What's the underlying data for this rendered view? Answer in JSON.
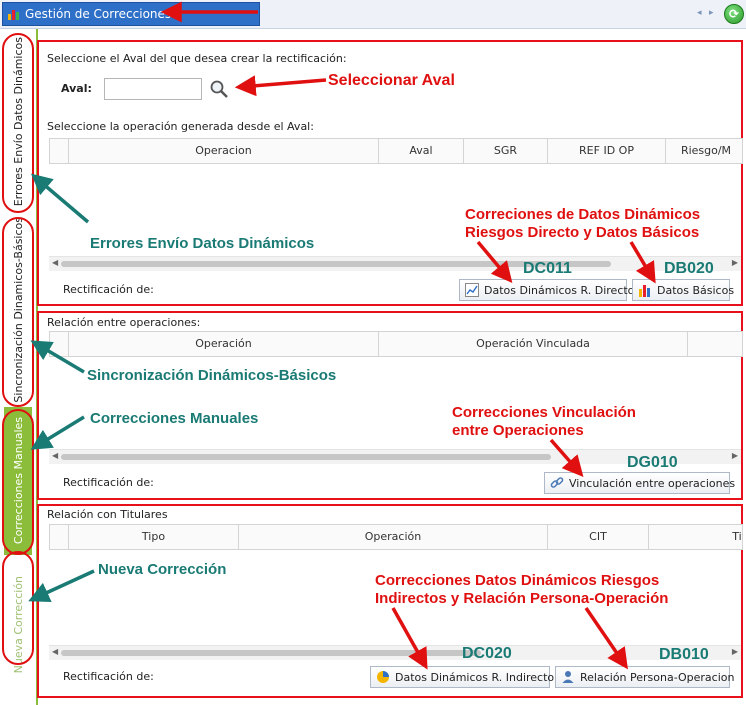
{
  "window": {
    "title": "Gestión de Correcciones",
    "nav_left": "◂",
    "nav_right": "▸"
  },
  "tabs": [
    {
      "label": "Errores Envío Datos Dinámicos"
    },
    {
      "label": "Sincronización Dinamicos-Básicos"
    },
    {
      "label": "Correcciones Manuales"
    },
    {
      "label": "Nueva Corrección"
    }
  ],
  "panel1": {
    "prompt": "Seleccione el Aval del que desea crear la rectificación:",
    "aval_label": "Aval:",
    "aval_value": "",
    "operation_prompt": "Seleccione la operación generada desde el Aval:",
    "columns": [
      "Operacion",
      "Aval",
      "SGR",
      "REF ID OP",
      "Riesgo/M"
    ],
    "rect_label": "Rectificación de:",
    "btn_directo": "Datos Dinámicos R. Directo",
    "btn_basicos": "Datos Básicos"
  },
  "panel2": {
    "title": "Relación entre operaciones:",
    "columns": [
      "Operación",
      "Operación Vinculada"
    ],
    "rect_label": "Rectificación de:",
    "btn_vinculacion": "Vinculación entre operaciones"
  },
  "panel3": {
    "title": "Relación con Titulares",
    "columns": [
      "Tipo",
      "Operación",
      "CIT",
      "Tit"
    ],
    "rect_label": "Rectificación de:",
    "btn_indirecto": "Datos Dinámicos R. Indirecto",
    "btn_persona": "Relación Persona-Operacion"
  },
  "annotations": {
    "seleccionar_aval": "Seleccionar Aval",
    "errores_envio": "Errores Envío Datos Dinámicos",
    "sincronizacion": "Sincronización Dinámicos-Básicos",
    "correcciones_manuales": "Correcciones Manuales",
    "nueva_correccion": "Nueva Corrección",
    "dd_line1": "Correciones de Datos Dinámicos",
    "dd_line2": "Riesgos Directo y Datos Básicos",
    "vinc_line1": "Correcciones Vinculación",
    "vinc_line2": "entre Operaciones",
    "ind_line1": "Correcciones Datos Dinámicos Riesgos",
    "ind_line2": "Indirectos y Relación Persona-Operación",
    "code_dc011": "DC011",
    "code_db020": "DB020",
    "code_dg010": "DG010",
    "code_dc020": "DC020",
    "code_db010": "DB010"
  },
  "colors": {
    "accent": "#2e6fc8",
    "annotation_red": "#e01010",
    "annotation_teal": "#1a7a74",
    "active_tab": "#8bbd3a"
  },
  "icons": [
    "chart-icon",
    "refresh-icon",
    "search-icon",
    "line-chart-icon",
    "bar-chart-icon",
    "link-icon",
    "pie-chart-icon",
    "person-icon"
  ]
}
